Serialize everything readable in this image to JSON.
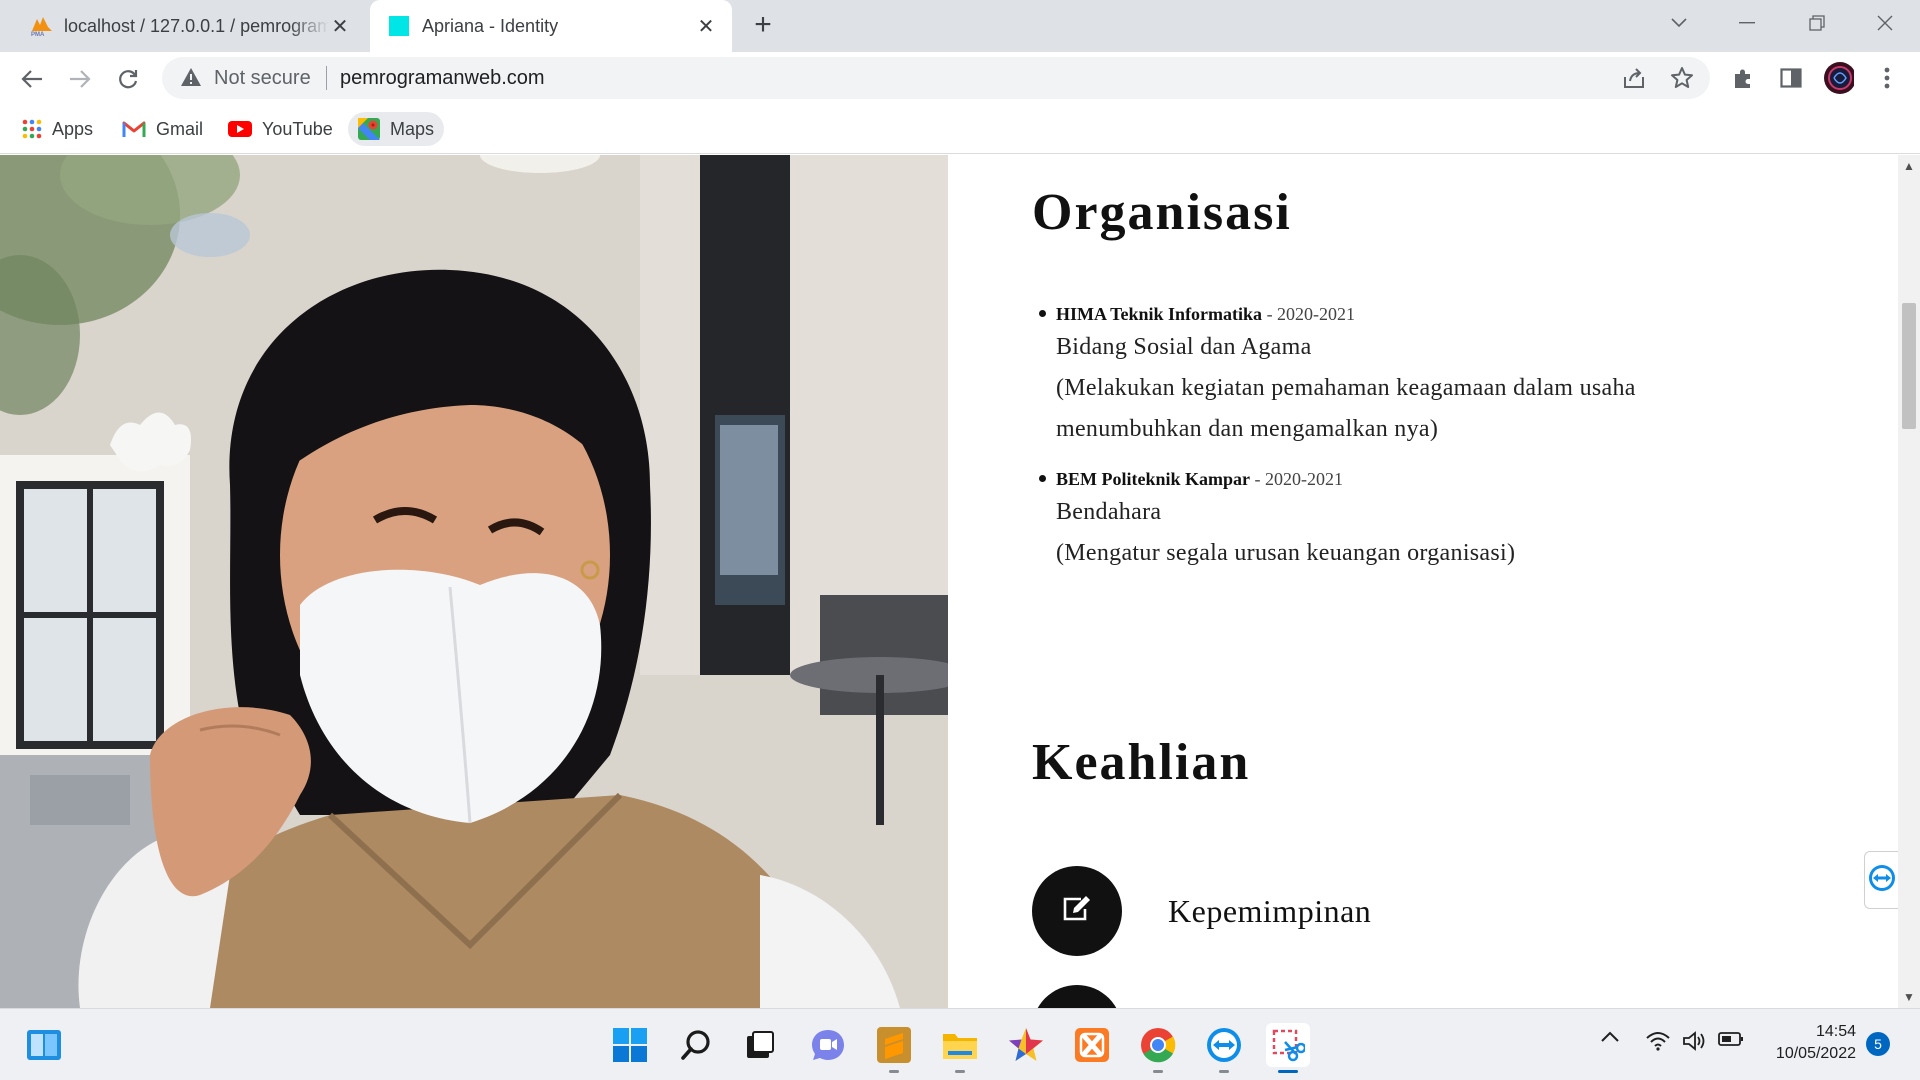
{
  "browser": {
    "tabs": [
      {
        "title": "localhost / 127.0.0.1 / pemrograman",
        "favicon": "phpmyadmin-icon",
        "active": false
      },
      {
        "title": "Apriana - Identity",
        "favicon": "cyan-square-icon",
        "active": true
      }
    ],
    "address": {
      "security_label": "Not secure",
      "url": "pemrogramanweb.com"
    },
    "bookmarks": [
      {
        "label": "Apps",
        "icon": "apps-grid-icon"
      },
      {
        "label": "Gmail",
        "icon": "gmail-icon"
      },
      {
        "label": "YouTube",
        "icon": "youtube-icon"
      },
      {
        "label": "Maps",
        "icon": "maps-icon"
      }
    ]
  },
  "page": {
    "organisasi": {
      "heading": "Organisasi",
      "items": [
        {
          "name": "HIMA Teknik Informatika",
          "years": " - 2020-2021",
          "role": "Bidang Sosial dan Agama",
          "desc": "(Melakukan kegiatan pemahaman keagamaan dalam usaha menumbuhkan dan mengamalkan nya)"
        },
        {
          "name": "BEM Politeknik Kampar",
          "years": " - 2020-2021",
          "role": "Bendahara",
          "desc": "(Mengatur segala urusan keuangan organisasi)"
        }
      ]
    },
    "keahlian": {
      "heading": "Keahlian",
      "items": [
        {
          "label": "Kepemimpinan",
          "icon": "edit-icon"
        }
      ]
    }
  },
  "taskbar": {
    "apps": [
      "widgets-icon",
      "windows-start-icon",
      "search-icon",
      "task-view-icon",
      "teams-chat-icon",
      "sublime-text-icon",
      "file-explorer-icon",
      "star-app-icon",
      "xampp-icon",
      "chrome-icon",
      "teamviewer-icon",
      "snipping-tool-icon"
    ],
    "time": "14:54",
    "date": "10/05/2022",
    "notifications": "5"
  },
  "colors": {
    "accent": "#0067c0",
    "page_text": "#111111",
    "tabstrip": "#dee1e6"
  }
}
